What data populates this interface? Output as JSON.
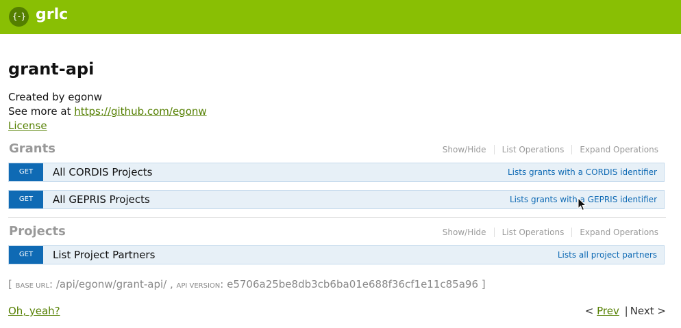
{
  "header": {
    "logo_glyph": "{-}",
    "brand": "grlc",
    "brand_color": "#89bf04"
  },
  "api": {
    "title": "grant-api",
    "created_by": "Created by egonw",
    "see_more_prefix": "See more at ",
    "see_more_link": "https://github.com/egonw",
    "license": "License"
  },
  "section_ops": {
    "show_hide": "Show/Hide",
    "list": "List Operations",
    "expand": "Expand Operations"
  },
  "sections": [
    {
      "title": "Grants",
      "operations": [
        {
          "method": "GET",
          "path": "All CORDIS Projects",
          "summary": "Lists grants with a CORDIS identifier"
        },
        {
          "method": "GET",
          "path": "All GEPRIS Projects",
          "summary": "Lists grants with a GEPRIS identifier"
        }
      ]
    },
    {
      "title": "Projects",
      "operations": [
        {
          "method": "GET",
          "path": "List Project Partners",
          "summary": "Lists all project partners"
        }
      ]
    }
  ],
  "footer": {
    "open_bracket": "[ ",
    "base_url_label": "base url",
    "base_url": ": /api/egonw/grant-api/ , ",
    "api_version_label": "api version",
    "api_version": ": e5706a25be8db3cb6ba01e688f36cf1e11c85a96 ]",
    "oh_yeah": "Oh, yeah?"
  },
  "pager": {
    "lt": "<",
    "prev": "Prev",
    "sep": "|",
    "next": "Next",
    "gt": ">"
  },
  "colors": {
    "method_get": "#0f6ab4",
    "op_bg": "#e7f0f7",
    "link": "#547f00"
  }
}
